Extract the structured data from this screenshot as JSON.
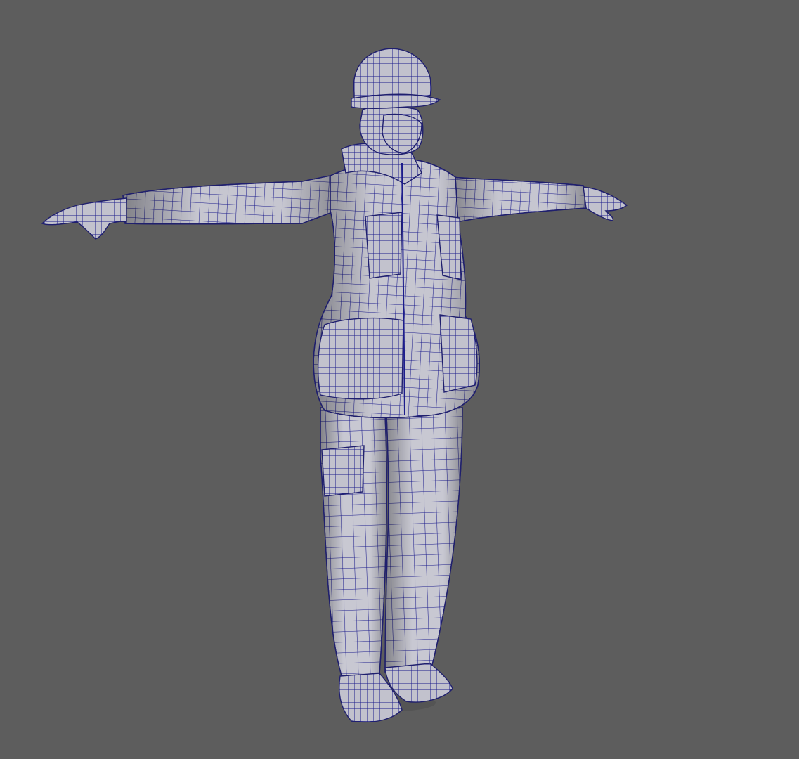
{
  "viewport": {
    "background_color": "#5d5d5d",
    "shading_mode": "wireframe-on-shaded",
    "wireframe_color": "#1c1c8c",
    "mesh_color": "#c9c9d3",
    "model": "worker-character-t-pose"
  }
}
